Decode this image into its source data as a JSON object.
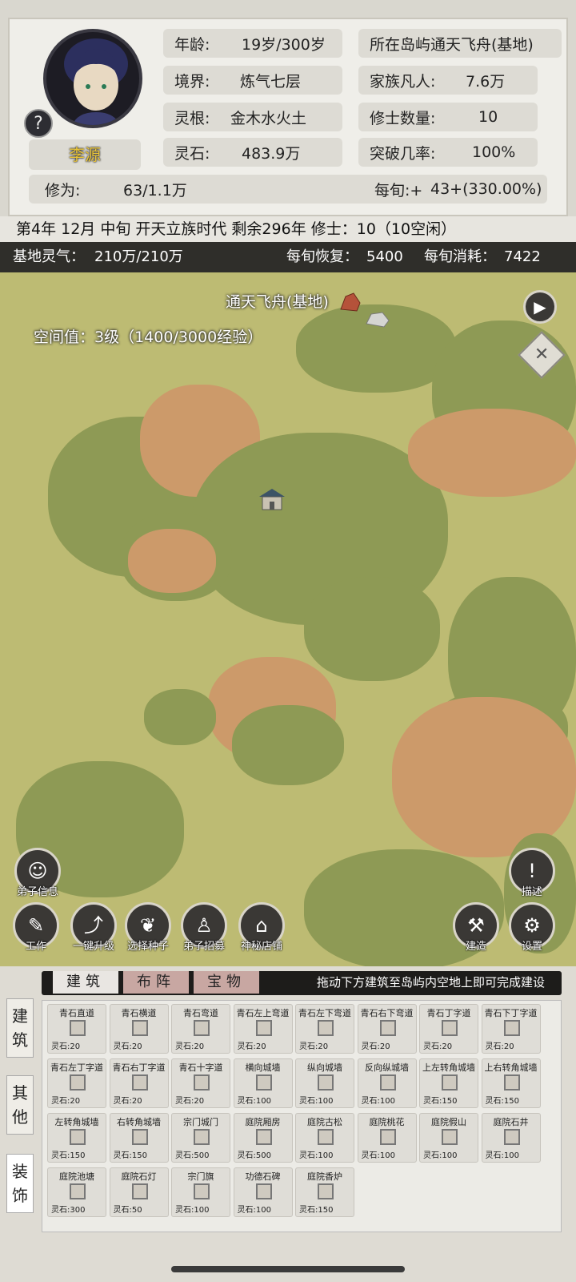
{
  "player": {
    "name": "李源"
  },
  "stats": {
    "age_label": "年龄:",
    "age": "19岁/300岁",
    "realm_label": "境界:",
    "realm": "炼气七层",
    "root_label": "灵根:",
    "root": "金木水火土",
    "stone_label": "灵石:",
    "stone": "483.9万",
    "island_label": "所在岛屿",
    "island": "通天飞舟(基地)",
    "family_label": "家族凡人:",
    "family": "7.6万",
    "cultivator_label": "修士数量:",
    "cultivator": "10",
    "breakthrough_label": "突破几率:",
    "breakthrough": "100%",
    "cultivation_label": "修为:",
    "cultivation": "63/1.1万",
    "perturn_label": "每旬:+ ",
    "perturn": "43+(330.00%)"
  },
  "info_line": "第4年 12月 中旬  开天立族时代 剩余296年  修士：10（10空闲）",
  "base": {
    "qi_label": "基地灵气：",
    "qi": "210万/210万",
    "recover_label": "每旬恢复：",
    "recover": "5400",
    "consume_label": "每旬消耗：",
    "consume": "7422"
  },
  "map": {
    "base_name": "通天飞舟(基地)",
    "space_value": "空间值：3级（1400/3000经验）"
  },
  "buttons": {
    "disciple_info": "弟子信息",
    "work": "工作",
    "upgrade": "一键升级",
    "seed": "选择种子",
    "recruit": "弟子招募",
    "shop": "神秘店铺",
    "describe": "描述",
    "build": "建造",
    "settings": "设置"
  },
  "tabs": {
    "building": "建筑",
    "formation": "布阵",
    "treasure": "宝物"
  },
  "hint": "拖动下方建筑至岛屿内空地上即可完成建设",
  "side_tabs": {
    "build": "建筑",
    "other": "其他",
    "decor": "装饰"
  },
  "items": [
    {
      "name": "青石直道",
      "price": "灵石:20"
    },
    {
      "name": "青石横道",
      "price": "灵石:20"
    },
    {
      "name": "青石弯道",
      "price": "灵石:20"
    },
    {
      "name": "青石左上弯道",
      "price": "灵石:20"
    },
    {
      "name": "青石左下弯道",
      "price": "灵石:20"
    },
    {
      "name": "青石右下弯道",
      "price": "灵石:20"
    },
    {
      "name": "青石丁字道",
      "price": "灵石:20"
    },
    {
      "name": "青石下丁字道",
      "price": "灵石:20"
    },
    {
      "name": "青石左丁字道",
      "price": "灵石:20"
    },
    {
      "name": "青石右丁字道",
      "price": "灵石:20"
    },
    {
      "name": "青石十字道",
      "price": "灵石:20"
    },
    {
      "name": "横向城墙",
      "price": "灵石:100"
    },
    {
      "name": "纵向城墙",
      "price": "灵石:100"
    },
    {
      "name": "反向纵城墙",
      "price": "灵石:100"
    },
    {
      "name": "上左转角城墙",
      "price": "灵石:150"
    },
    {
      "name": "上右转角城墙",
      "price": "灵石:150"
    },
    {
      "name": "左转角城墙",
      "price": "灵石:150"
    },
    {
      "name": "右转角城墙",
      "price": "灵石:150"
    },
    {
      "name": "宗门城门",
      "price": "灵石:500"
    },
    {
      "name": "庭院厢房",
      "price": "灵石:500"
    },
    {
      "name": "庭院古松",
      "price": "灵石:100"
    },
    {
      "name": "庭院桃花",
      "price": "灵石:100"
    },
    {
      "name": "庭院假山",
      "price": "灵石:100"
    },
    {
      "name": "庭院石井",
      "price": "灵石:100"
    },
    {
      "name": "庭院池塘",
      "price": "灵石:300"
    },
    {
      "name": "庭院石灯",
      "price": "灵石:50"
    },
    {
      "name": "宗门旗",
      "price": "灵石:100"
    },
    {
      "name": "功德石碑",
      "price": "灵石:100"
    },
    {
      "name": "庭院香炉",
      "price": "灵石:150"
    }
  ]
}
